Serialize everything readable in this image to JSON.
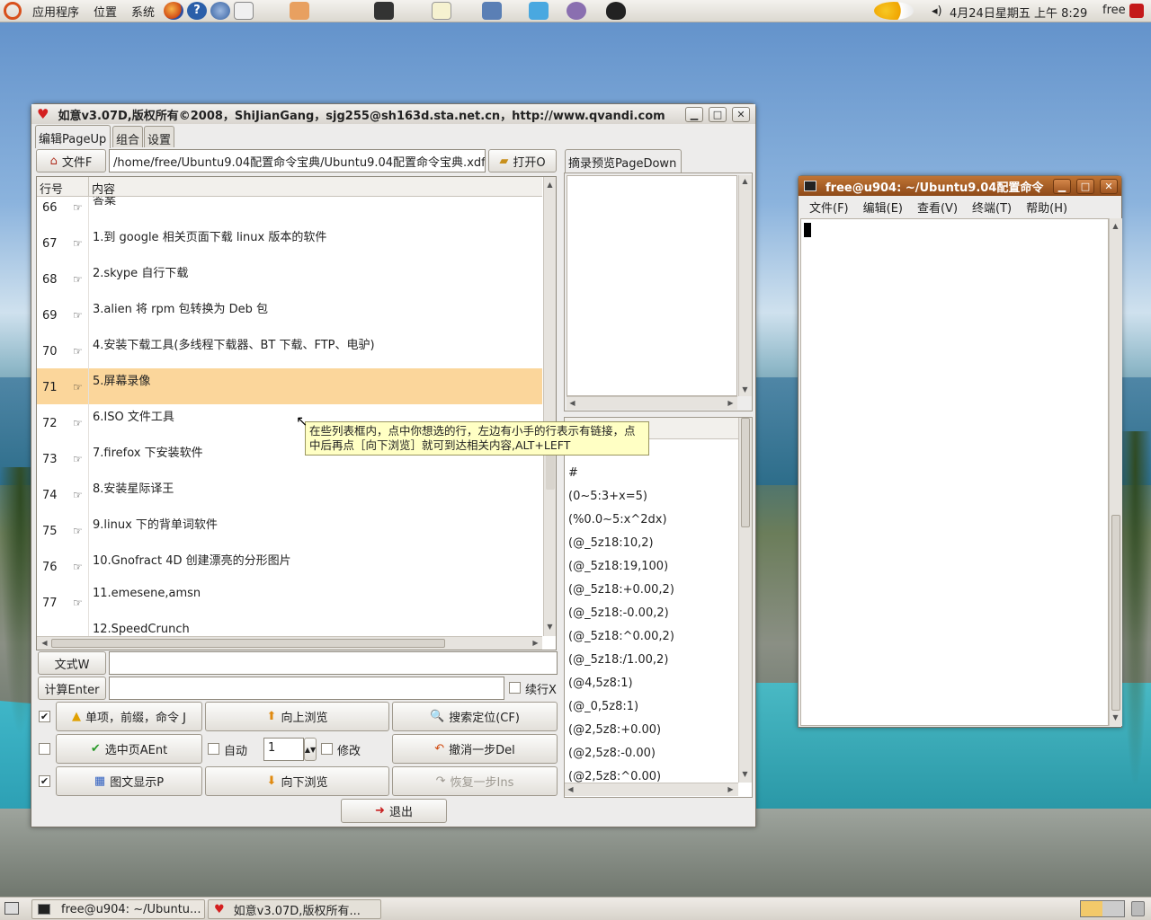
{
  "top_panel": {
    "menus": [
      "应用程序",
      "位置",
      "系统"
    ],
    "clock": "4月24日星期五 上午 8:29",
    "user": "free"
  },
  "app_window": {
    "title": "如意v3.07D,版权所有©2008，ShiJianGang，sjg255@sh163d.sta.net.cn，http://www.qvandi.com",
    "tabs": [
      "编辑PageUp",
      "组合",
      "设置"
    ],
    "file_button": "文件F",
    "path_value": "/home/free/Ubuntu9.04配置命令宝典/Ubuntu9.04配置命令宝典.xdf",
    "open_button": "打开O",
    "table": {
      "headers": [
        "行号",
        "内容"
      ],
      "partial_top": "答案",
      "rows": [
        {
          "num": "66",
          "text": ""
        },
        {
          "num": "67",
          "text": "1.到 google 相关页面下载 linux 版本的软件"
        },
        {
          "num": "68",
          "text": "2.skype 自行下载"
        },
        {
          "num": "69",
          "text": "3.alien 将 rpm 包转换为 Deb 包"
        },
        {
          "num": "70",
          "text": "4.安装下载工具(多线程下载器、BT 下载、FTP、电驴)"
        },
        {
          "num": "71",
          "text": "5.屏幕录像"
        },
        {
          "num": "72",
          "text": "6.ISO 文件工具"
        },
        {
          "num": "73",
          "text": "7.firefox 下安装软件"
        },
        {
          "num": "74",
          "text": "8.安装星际译王"
        },
        {
          "num": "75",
          "text": "9.linux 下的背单词软件"
        },
        {
          "num": "76",
          "text": "10.Gnofract 4D 创建漂亮的分形图片"
        },
        {
          "num": "77",
          "text": "11.emesene,amsn"
        },
        {
          "num": "",
          "text": "12.SpeedCrunch"
        }
      ],
      "selected_row": "71"
    },
    "tooltip": "在些列表框内，点中你想选的行，左边有小手的行表示有链接，点中后再点［向下浏览］就可到达相关内容,ALT+LEFT",
    "preview_tab": "摘录预览PageDown",
    "formula_button": "文式W",
    "formula_value": "",
    "calc_button": "计算Enter",
    "calc_value": "",
    "continue_label": "续行X",
    "buttons": {
      "single": "单项，前缀，命令 J",
      "browse_up": "向上浏览",
      "search": "搜索定位(CF)",
      "select_page": "选中页AEnt",
      "auto_label": "自动",
      "spin_value": "1",
      "modify_label": "修改",
      "undo": "撤消一步Del",
      "graphic": "图文显示P",
      "browse_down": "向下浏览",
      "redo": "恢复一步Ins",
      "exit": "退出"
    },
    "list_items": [
      "#",
      "(0~5:3+x=5)",
      "(%0.0~5:x^2dx)",
      "(@_5z18:10,2)",
      "(@_5z18:19,100)",
      "(@_5z18:+0.00,2)",
      "(@_5z18:-0.00,2)",
      "(@_5z18:^0.00,2)",
      "(@_5z18:/1.00,2)",
      "(@4,5z8:1)",
      "(@_0,5z8:1)",
      "(@2,5z8:+0.00)",
      "(@2,5z8:-0.00)",
      "(@2,5z8:^0.00)"
    ]
  },
  "terminal_window": {
    "title": "free@u904: ~/Ubuntu9.04配置命令",
    "menus": [
      "文件(F)",
      "编辑(E)",
      "查看(V)",
      "终端(T)",
      "帮助(H)"
    ]
  },
  "taskbar": {
    "tasks": [
      "free@u904: ~/Ubuntu...",
      "如意v3.07D,版权所有..."
    ]
  },
  "colors": {
    "selection": "#fbd69b",
    "tooltip": "#ffffc4",
    "terminal_title": "#a45a22"
  }
}
